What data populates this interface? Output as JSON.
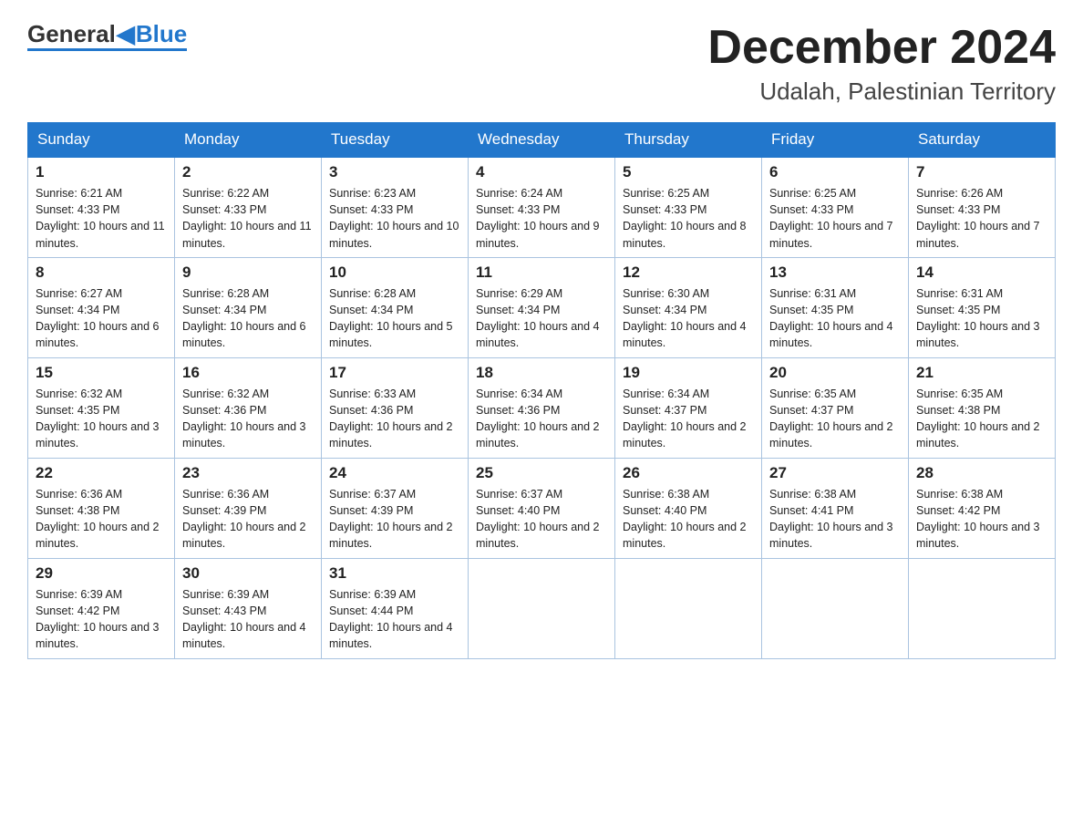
{
  "logo": {
    "general": "General",
    "blue": "Blue"
  },
  "header": {
    "month": "December 2024",
    "location": "Udalah, Palestinian Territory"
  },
  "days_of_week": [
    "Sunday",
    "Monday",
    "Tuesday",
    "Wednesday",
    "Thursday",
    "Friday",
    "Saturday"
  ],
  "weeks": [
    [
      {
        "day": "1",
        "sunrise": "6:21 AM",
        "sunset": "4:33 PM",
        "daylight": "10 hours and 11 minutes."
      },
      {
        "day": "2",
        "sunrise": "6:22 AM",
        "sunset": "4:33 PM",
        "daylight": "10 hours and 11 minutes."
      },
      {
        "day": "3",
        "sunrise": "6:23 AM",
        "sunset": "4:33 PM",
        "daylight": "10 hours and 10 minutes."
      },
      {
        "day": "4",
        "sunrise": "6:24 AM",
        "sunset": "4:33 PM",
        "daylight": "10 hours and 9 minutes."
      },
      {
        "day": "5",
        "sunrise": "6:25 AM",
        "sunset": "4:33 PM",
        "daylight": "10 hours and 8 minutes."
      },
      {
        "day": "6",
        "sunrise": "6:25 AM",
        "sunset": "4:33 PM",
        "daylight": "10 hours and 7 minutes."
      },
      {
        "day": "7",
        "sunrise": "6:26 AM",
        "sunset": "4:33 PM",
        "daylight": "10 hours and 7 minutes."
      }
    ],
    [
      {
        "day": "8",
        "sunrise": "6:27 AM",
        "sunset": "4:34 PM",
        "daylight": "10 hours and 6 minutes."
      },
      {
        "day": "9",
        "sunrise": "6:28 AM",
        "sunset": "4:34 PM",
        "daylight": "10 hours and 6 minutes."
      },
      {
        "day": "10",
        "sunrise": "6:28 AM",
        "sunset": "4:34 PM",
        "daylight": "10 hours and 5 minutes."
      },
      {
        "day": "11",
        "sunrise": "6:29 AM",
        "sunset": "4:34 PM",
        "daylight": "10 hours and 4 minutes."
      },
      {
        "day": "12",
        "sunrise": "6:30 AM",
        "sunset": "4:34 PM",
        "daylight": "10 hours and 4 minutes."
      },
      {
        "day": "13",
        "sunrise": "6:31 AM",
        "sunset": "4:35 PM",
        "daylight": "10 hours and 4 minutes."
      },
      {
        "day": "14",
        "sunrise": "6:31 AM",
        "sunset": "4:35 PM",
        "daylight": "10 hours and 3 minutes."
      }
    ],
    [
      {
        "day": "15",
        "sunrise": "6:32 AM",
        "sunset": "4:35 PM",
        "daylight": "10 hours and 3 minutes."
      },
      {
        "day": "16",
        "sunrise": "6:32 AM",
        "sunset": "4:36 PM",
        "daylight": "10 hours and 3 minutes."
      },
      {
        "day": "17",
        "sunrise": "6:33 AM",
        "sunset": "4:36 PM",
        "daylight": "10 hours and 2 minutes."
      },
      {
        "day": "18",
        "sunrise": "6:34 AM",
        "sunset": "4:36 PM",
        "daylight": "10 hours and 2 minutes."
      },
      {
        "day": "19",
        "sunrise": "6:34 AM",
        "sunset": "4:37 PM",
        "daylight": "10 hours and 2 minutes."
      },
      {
        "day": "20",
        "sunrise": "6:35 AM",
        "sunset": "4:37 PM",
        "daylight": "10 hours and 2 minutes."
      },
      {
        "day": "21",
        "sunrise": "6:35 AM",
        "sunset": "4:38 PM",
        "daylight": "10 hours and 2 minutes."
      }
    ],
    [
      {
        "day": "22",
        "sunrise": "6:36 AM",
        "sunset": "4:38 PM",
        "daylight": "10 hours and 2 minutes."
      },
      {
        "day": "23",
        "sunrise": "6:36 AM",
        "sunset": "4:39 PM",
        "daylight": "10 hours and 2 minutes."
      },
      {
        "day": "24",
        "sunrise": "6:37 AM",
        "sunset": "4:39 PM",
        "daylight": "10 hours and 2 minutes."
      },
      {
        "day": "25",
        "sunrise": "6:37 AM",
        "sunset": "4:40 PM",
        "daylight": "10 hours and 2 minutes."
      },
      {
        "day": "26",
        "sunrise": "6:38 AM",
        "sunset": "4:40 PM",
        "daylight": "10 hours and 2 minutes."
      },
      {
        "day": "27",
        "sunrise": "6:38 AM",
        "sunset": "4:41 PM",
        "daylight": "10 hours and 3 minutes."
      },
      {
        "day": "28",
        "sunrise": "6:38 AM",
        "sunset": "4:42 PM",
        "daylight": "10 hours and 3 minutes."
      }
    ],
    [
      {
        "day": "29",
        "sunrise": "6:39 AM",
        "sunset": "4:42 PM",
        "daylight": "10 hours and 3 minutes."
      },
      {
        "day": "30",
        "sunrise": "6:39 AM",
        "sunset": "4:43 PM",
        "daylight": "10 hours and 4 minutes."
      },
      {
        "day": "31",
        "sunrise": "6:39 AM",
        "sunset": "4:44 PM",
        "daylight": "10 hours and 4 minutes."
      },
      null,
      null,
      null,
      null
    ]
  ]
}
